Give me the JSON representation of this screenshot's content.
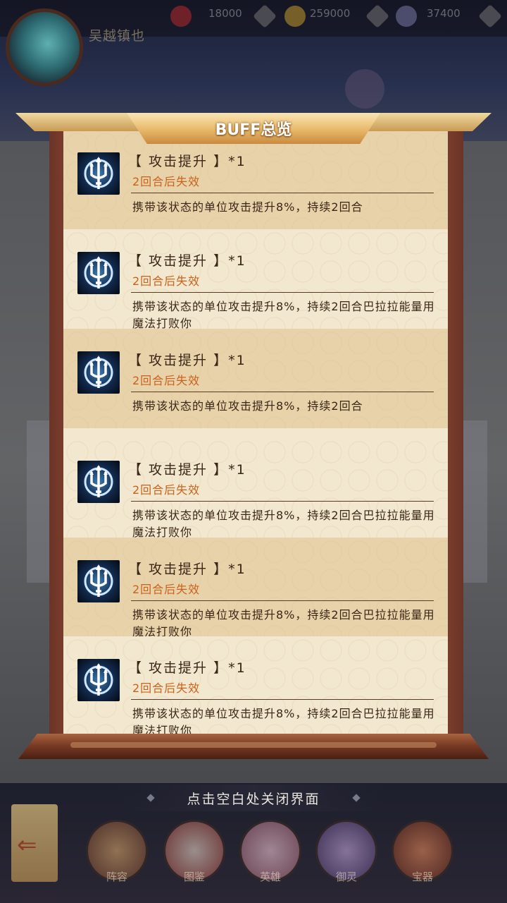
{
  "topbar": {
    "player_name": "吴越镇也",
    "resources": [
      "18000",
      "259000",
      "37400"
    ]
  },
  "panel": {
    "title": "BUFF总览",
    "buffs": [
      {
        "name": "【 攻击提升 】*1",
        "duration": "2回合后失效",
        "desc": "携带该状态的单位攻击提升8%，持续2回合"
      },
      {
        "name": "【 攻击提升 】*1",
        "duration": "2回合后失效",
        "desc": "携带该状态的单位攻击提升8%，持续2回合巴拉拉能量用魔法打败你"
      },
      {
        "name": "【 攻击提升 】*1",
        "duration": "2回合后失效",
        "desc": "携带该状态的单位攻击提升8%，持续2回合"
      },
      {
        "name": "【 攻击提升 】*1",
        "duration": "2回合后失效",
        "desc": "携带该状态的单位攻击提升8%，持续2回合巴拉拉能量用魔法打败你"
      },
      {
        "name": "【 攻击提升 】*1",
        "duration": "2回合后失效",
        "desc": "携带该状态的单位攻击提升8%，持续2回合巴拉拉能量用魔法打败你"
      },
      {
        "name": "【 攻击提升 】*1",
        "duration": "2回合后失效",
        "desc": "携带该状态的单位攻击提升8%，持续2回合巴拉拉能量用魔法打败你"
      }
    ],
    "buff_icon": "trident-icon"
  },
  "hint": "点击空白处关闭界面",
  "nav": {
    "items": [
      "阵容",
      "图鉴",
      "英雄",
      "御灵",
      "宝器"
    ]
  },
  "colors": {
    "duration_text": "#c9631b",
    "title_text": "#ffffff",
    "paper": "#f2e7cf",
    "paper_alt": "#e7d2aa"
  }
}
